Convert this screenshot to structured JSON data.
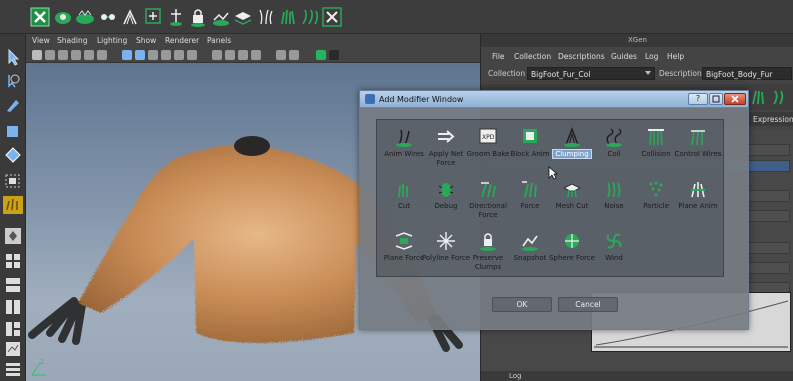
{
  "colors": {
    "maya_green": "#25b55a",
    "dialog_title_blue": "#a6c3e4",
    "selected_highlight": "#7fa2cc",
    "fur_orange": "#c98c56"
  },
  "shelf": {
    "icons": [
      "xgen-window-icon",
      "groom-icon",
      "fur-icon",
      "connect-icon",
      "clumping-icon",
      "add-icon",
      "pin-icon",
      "lock-icon",
      "scene-icon",
      "layers-icon",
      "hair-plus-icon",
      "grass-icon",
      "wave-icon",
      "select-guides-icon"
    ]
  },
  "viewport": {
    "menu": [
      "View",
      "Shading",
      "Lighting",
      "Show",
      "Renderer",
      "Panels"
    ],
    "axis_label": "z"
  },
  "xgen": {
    "title": "XGen",
    "menu": [
      "File",
      "Collection",
      "Descriptions",
      "Guides",
      "Log",
      "Help"
    ],
    "collection_label": "Collection",
    "collection_value": "BigFoot_Fur_Col",
    "description_label": "Description",
    "description_value": "BigFoot_Body_Fur",
    "tab_partial": "Expressions",
    "log_label": "Log"
  },
  "dialog": {
    "title": "Add Modifier Window",
    "help_label": "?",
    "ok_label": "OK",
    "cancel_label": "Cancel",
    "modifiers": [
      {
        "label": "Anim Wires",
        "icon": "anim-wires-icon"
      },
      {
        "label": "Apply Net Force",
        "icon": "apply-net-force-icon"
      },
      {
        "label": "Groom Bake",
        "icon": "groom-bake-icon"
      },
      {
        "label": "Block Anim",
        "icon": "block-anim-icon"
      },
      {
        "label": "Clumping",
        "icon": "clumping-icon",
        "selected": true
      },
      {
        "label": "Coil",
        "icon": "coil-icon"
      },
      {
        "label": "Collision",
        "icon": "collision-icon"
      },
      {
        "label": "Control Wires",
        "icon": "control-wires-icon"
      },
      {
        "label": "Cut",
        "icon": "cut-icon"
      },
      {
        "label": "Debug",
        "icon": "debug-icon"
      },
      {
        "label": "Directional Force",
        "icon": "directional-force-icon"
      },
      {
        "label": "Force",
        "icon": "force-icon"
      },
      {
        "label": "Mesh Cut",
        "icon": "mesh-cut-icon"
      },
      {
        "label": "Noise",
        "icon": "noise-icon"
      },
      {
        "label": "Particle",
        "icon": "particle-icon"
      },
      {
        "label": "Plane Anim",
        "icon": "plane-anim-icon"
      },
      {
        "label": "Plane Force",
        "icon": "plane-force-icon"
      },
      {
        "label": "Polyline Force",
        "icon": "polyline-force-icon"
      },
      {
        "label": "Preserve Clumps",
        "icon": "preserve-clumps-icon"
      },
      {
        "label": "Snapshot",
        "icon": "snapshot-icon"
      },
      {
        "label": "Sphere Force",
        "icon": "sphere-force-icon"
      },
      {
        "label": "Wind",
        "icon": "wind-icon"
      }
    ]
  }
}
